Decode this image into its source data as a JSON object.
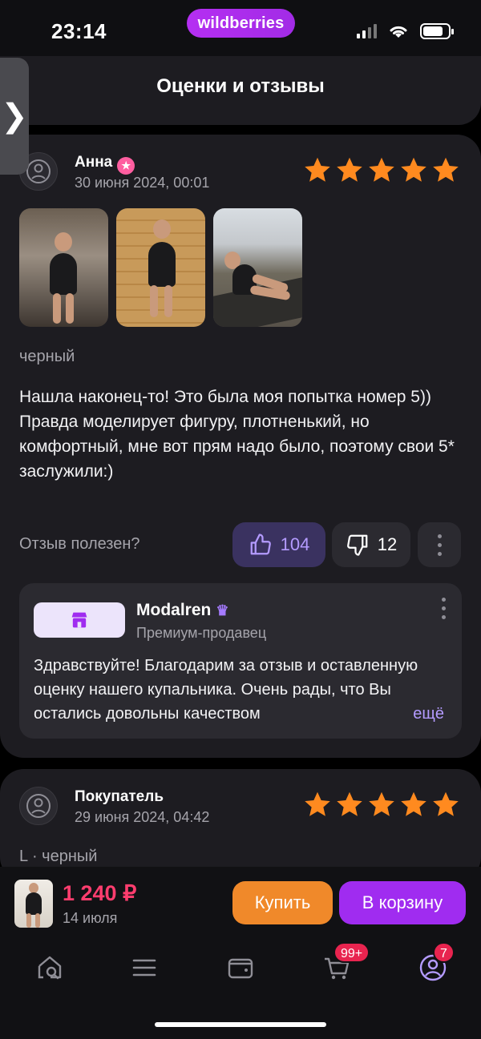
{
  "status_bar": {
    "time": "23:14",
    "brand": "wildberries"
  },
  "header": {
    "title": "Оценки и отзывы"
  },
  "reviews": [
    {
      "author": "Анна",
      "date": "30 июня 2024, 00:01",
      "rating": 5,
      "photos_count": 3,
      "variant": "черный",
      "text": "Нашла наконец-то! Это была моя попытка номер 5))\nПравда моделирует фигуру, плотненький, но комфортный, мне вот прям надо было, поэтому свои 5* заслужили:)",
      "helpful_label": "Отзыв полезен?",
      "likes": "104",
      "dislikes": "12",
      "seller_reply": {
        "seller_name": "Modalren",
        "seller_type": "Премиум-продавец",
        "text": "Здравствуйте! Благодарим за отзыв и оставленную оценку нашего купальника. Очень рады, что Вы остались довольны качеством",
        "more_label": "ещё"
      }
    },
    {
      "author": "Покупатель",
      "date": "29 июня 2024, 04:42",
      "rating": 5,
      "variant": "L · черный"
    }
  ],
  "buy_bar": {
    "price": "1 240 ₽",
    "delivery": "14 июля",
    "buy_label": "Купить",
    "cart_label": "В корзину"
  },
  "tab_bar": {
    "cart_badge": "99+",
    "profile_badge": "7"
  },
  "colors": {
    "accent_purple": "#a02cf0",
    "buy_orange": "#f0892a",
    "price_red": "#ff3d6e",
    "star_orange": "#ff8a1f"
  }
}
